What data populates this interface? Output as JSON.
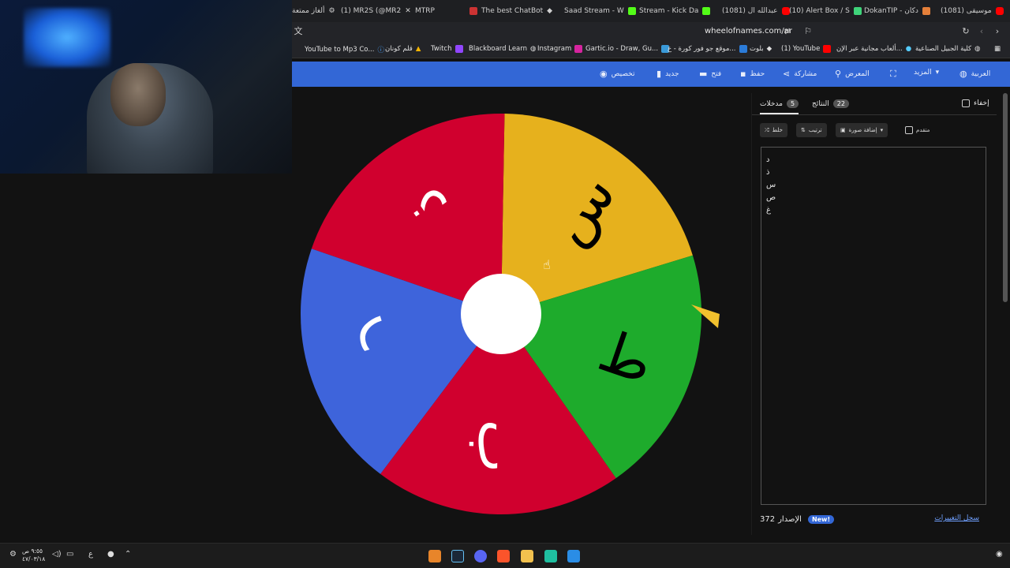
{
  "browser": {
    "tabs": [
      {
        "label": "ألغاز ممتعة",
        "icon": "gear-icon"
      },
      {
        "label": "(1) MR2S (@MR2",
        "icon": "x-logo-icon"
      },
      {
        "label": "MTRP",
        "icon": "tab-icon"
      },
      {
        "label": "The best ChatBot",
        "icon": "diamond-icon"
      },
      {
        "label": "Saad Stream - W",
        "icon": "kick-icon"
      },
      {
        "label": "Stream - Kick Da",
        "icon": "kick-icon"
      },
      {
        "label": "(1081) عبدالله ال",
        "icon": "youtube-icon"
      },
      {
        "label": "(10) Alert Box / S",
        "icon": "streamelements-icon"
      },
      {
        "label": "DokanTIP - دكان",
        "icon": "bag-icon"
      },
      {
        "label": "(1081) موسيقى",
        "icon": "youtube-icon"
      }
    ],
    "url": "wheelofnames.com/ar",
    "bookmarks": [
      "YouTube to Mp3 Co...",
      "قلم كونان",
      "Twitch",
      "Blackboard Learn",
      "Instagram",
      "Gartic.io - Draw, Gu...",
      "موقع جو فور كورة - ع...",
      "بلوت",
      "(1) YouTube",
      "ألعاب مجانية عبر الإن...",
      "كلية الجبيل الصناعية"
    ]
  },
  "toolbar": {
    "customize": "تخصيص",
    "new": "جديد",
    "open": "فتح",
    "save": "حفظ",
    "share": "مشاركة",
    "gallery": "المعرض",
    "more": "المزيد",
    "language": "العربية"
  },
  "wheel": {
    "segments": [
      {
        "label": "س",
        "color": "#e6b11d"
      },
      {
        "label": "ذ",
        "color": "#d0002e"
      },
      {
        "label": "ر",
        "color": "#3e64db"
      },
      {
        "label": "ب",
        "color": "#d0002e"
      },
      {
        "label": "ط",
        "color": "#1eab2c"
      }
    ],
    "center_color": "#ffffff",
    "pointer_color": "#f2c12e"
  },
  "panel": {
    "tab_entries": "مدخلات",
    "tab_entries_count": "5",
    "tab_results": "النتائج",
    "tab_results_count": "22",
    "hide_label": "إخفاء",
    "shuffle": "خلط",
    "sort": "ترتيب",
    "add_image": "إضافة صورة",
    "advanced": "متقدم",
    "entries": [
      "د",
      "ذ",
      "س",
      "ص",
      "غ"
    ],
    "version_label": "الإصدار",
    "version_number": "372",
    "new_badge": "New!",
    "changelog": "سجل التغييرات"
  },
  "taskbar": {
    "time": "٩:٥٥ ص",
    "date": "٤٧/٠٣/١٨",
    "lang": "ع"
  }
}
